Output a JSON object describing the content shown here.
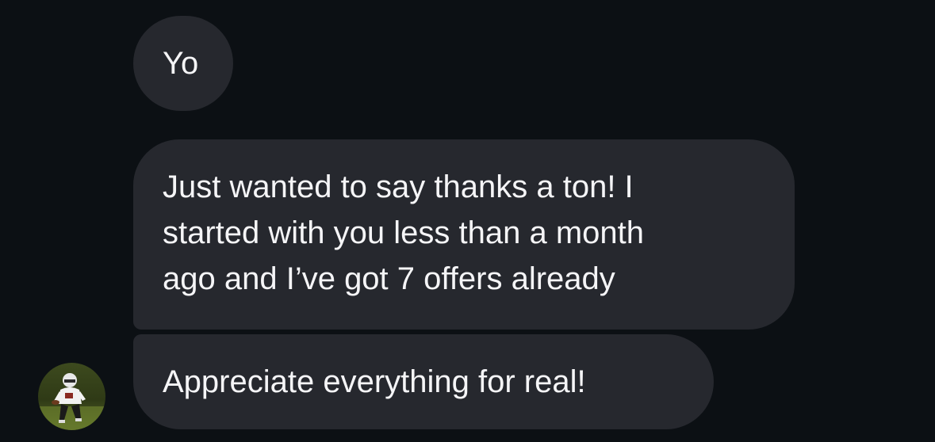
{
  "thread": {
    "messages": [
      {
        "sender": "them",
        "lines": [
          "Yo"
        ]
      },
      {
        "sender": "them",
        "lines": [
          "Just wanted to say thanks a ton! I",
          "started with you less than a month",
          "ago and I’ve got 7 offers already"
        ]
      },
      {
        "sender": "them",
        "lines": [
          "Appreciate everything for real!"
        ]
      }
    ],
    "avatar": {
      "icon": "football-player-photo-avatar"
    }
  },
  "colors": {
    "background": "#0c1014",
    "bubble": "#26282e",
    "text": "#f5f5f7"
  }
}
